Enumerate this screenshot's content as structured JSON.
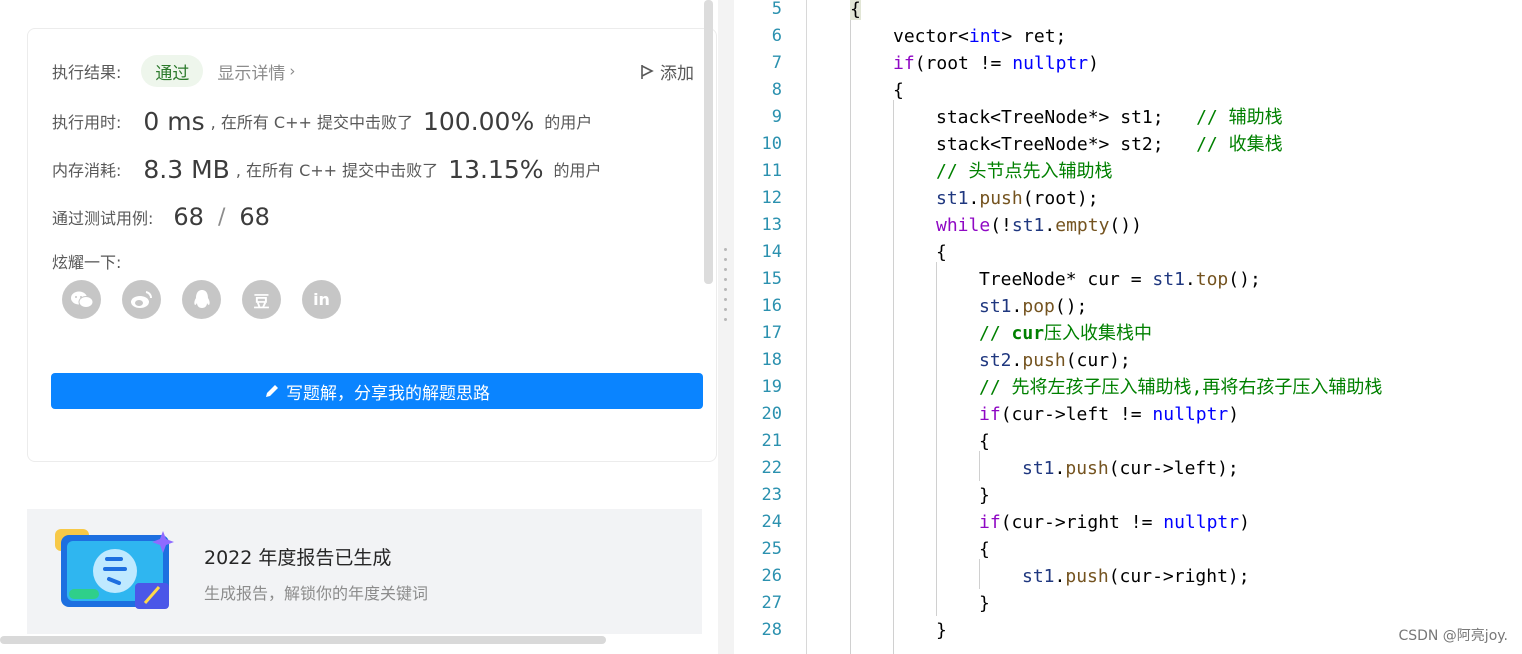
{
  "result": {
    "label": "执行结果:",
    "status": "通过",
    "details_link": "显示详情",
    "add_note": "添加"
  },
  "runtime": {
    "label": "执行用时:",
    "value": "0 ms",
    "beat_text": ", 在所有 C++ 提交中击败了",
    "percent": "100.00%",
    "tail": "的用户"
  },
  "memory": {
    "label": "内存消耗:",
    "value": "8.3 MB",
    "beat_text": ", 在所有 C++ 提交中击败了",
    "percent": "13.15%",
    "tail": "的用户"
  },
  "tests": {
    "label": "通过测试用例:",
    "passed": "68",
    "separator": "/",
    "total": "68"
  },
  "share": {
    "label": "炫耀一下:",
    "icons": [
      "wechat-icon",
      "weibo-icon",
      "qq-icon",
      "douban-icon",
      "linkedin-icon"
    ],
    "douban_glyph": "豆",
    "linkedin_glyph": "in"
  },
  "write_solution_label": "写题解，分享我的解题思路",
  "report": {
    "title": "2022 年度报告已生成",
    "subtitle": "生成报告，解锁你的年度关键词"
  },
  "editor": {
    "line_numbers": [
      "5",
      "6",
      "7",
      "8",
      "9",
      "10",
      "11",
      "12",
      "13",
      "14",
      "15",
      "16",
      "17",
      "18",
      "19",
      "20",
      "21",
      "22",
      "23",
      "24",
      "25",
      "26",
      "27",
      "28"
    ],
    "comments": {
      "aux_stack": "// 辅助栈",
      "collect_stack": "// 收集栈",
      "head_push": "// 头节点先入辅助栈",
      "cur_prefix": "// ",
      "cur_word": "cur",
      "cur_suffix": "压入收集栈中",
      "push_children": "// 先将左孩子压入辅助栈,再将右孩子压入辅助栈"
    }
  },
  "watermark": "CSDN @阿亮joy.",
  "colors": {
    "accent_blue": "#0a84ff",
    "pass_green": "#2c7a2c",
    "keyword_blue": "#0000ff",
    "control_purple": "#8f08c4",
    "comment_green": "#008000",
    "line_number": "#2b91af"
  }
}
